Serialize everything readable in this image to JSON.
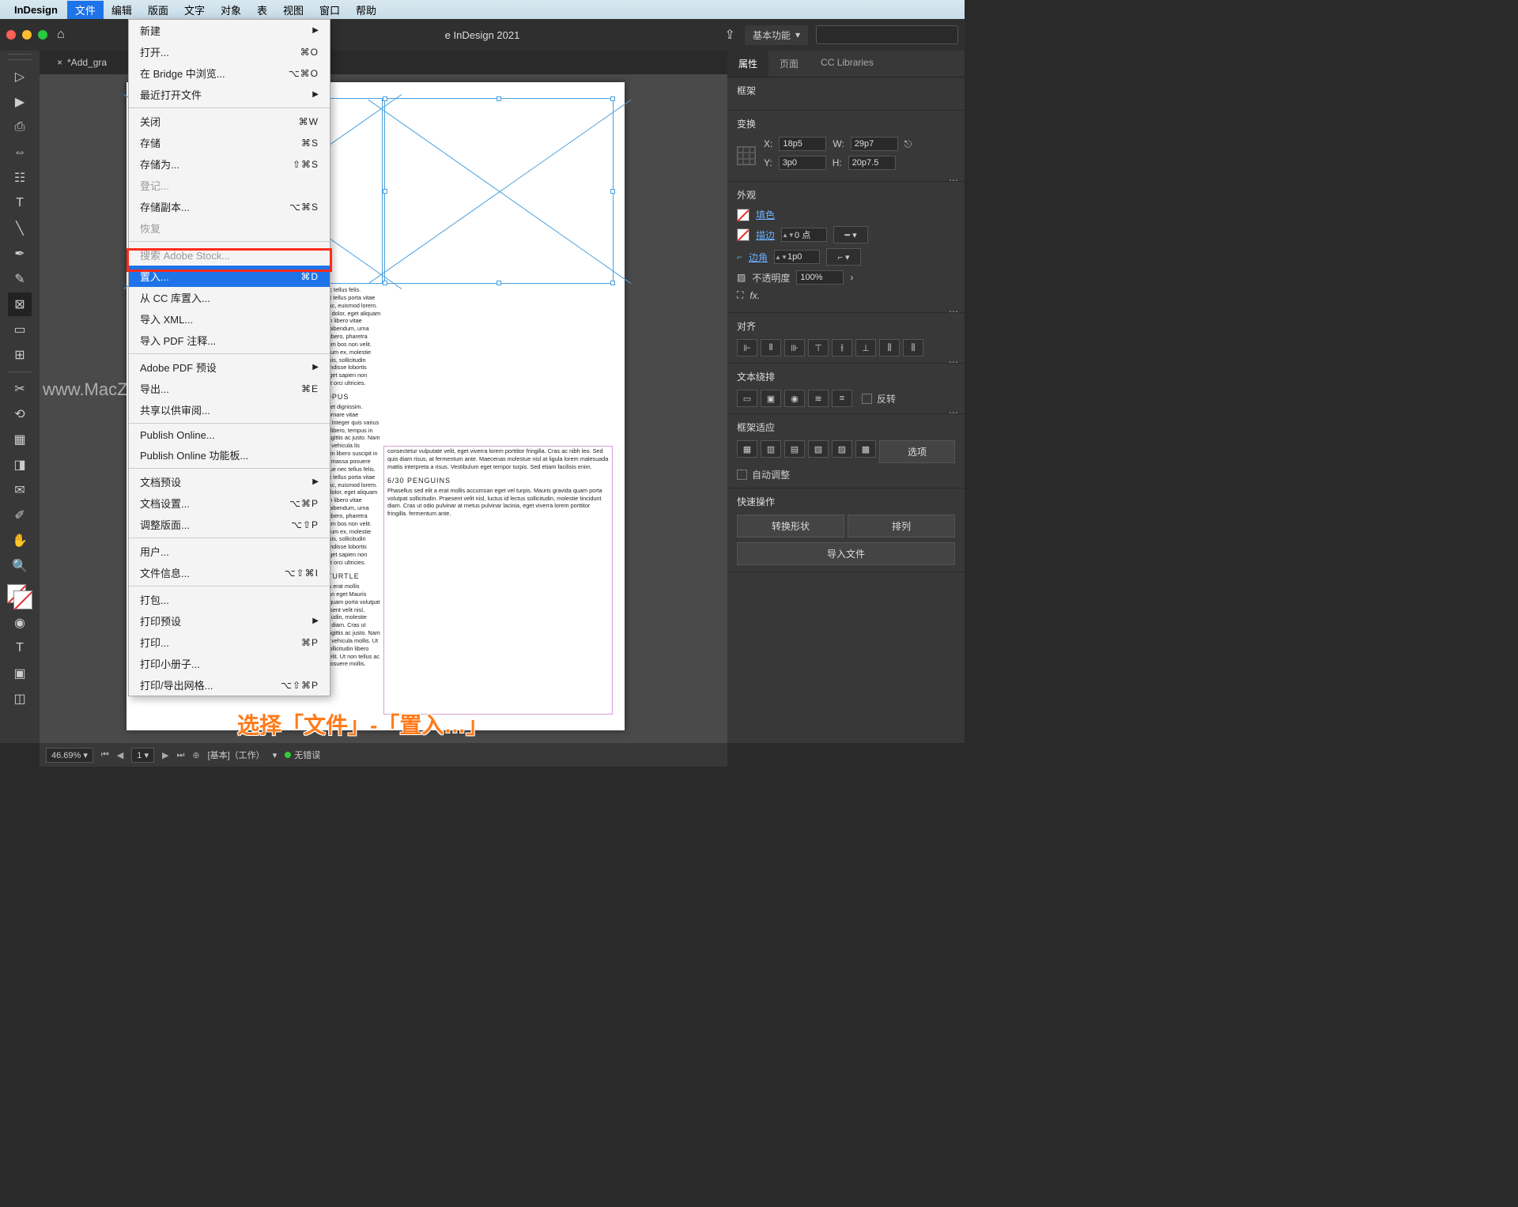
{
  "mac_menu": {
    "app_name": "InDesign",
    "items": [
      "文件",
      "编辑",
      "版面",
      "文字",
      "对象",
      "表",
      "视图",
      "窗口",
      "帮助"
    ],
    "active_index": 0
  },
  "app_bar": {
    "title": "e InDesign 2021",
    "workspace": "基本功能"
  },
  "document_tab": {
    "label": "*Add_gra",
    "close": "×"
  },
  "file_menu": [
    {
      "label": "新建",
      "arrow": true
    },
    {
      "label": "打开...",
      "shortcut": "⌘O"
    },
    {
      "label": "在 Bridge 中浏览...",
      "shortcut": "⌥⌘O"
    },
    {
      "label": "最近打开文件",
      "arrow": true
    },
    {
      "sep": true
    },
    {
      "label": "关闭",
      "shortcut": "⌘W"
    },
    {
      "label": "存储",
      "shortcut": "⌘S"
    },
    {
      "label": "存储为...",
      "shortcut": "⇧⌘S"
    },
    {
      "label": "登记...",
      "disabled": true
    },
    {
      "label": "存储副本...",
      "shortcut": "⌥⌘S"
    },
    {
      "label": "恢复",
      "disabled": true
    },
    {
      "sep": true
    },
    {
      "label": "搜索 Adobe Stock...",
      "disabled": true
    },
    {
      "label": "置入...",
      "shortcut": "⌘D",
      "highlighted": true
    },
    {
      "label": "从 CC 库置入..."
    },
    {
      "label": "导入 XML..."
    },
    {
      "label": "导入 PDF 注释..."
    },
    {
      "sep": true
    },
    {
      "label": "Adobe PDF 预设",
      "arrow": true
    },
    {
      "label": "导出...",
      "shortcut": "⌘E"
    },
    {
      "label": "共享以供审阅..."
    },
    {
      "sep": true
    },
    {
      "label": "Publish Online..."
    },
    {
      "label": "Publish Online 功能板..."
    },
    {
      "sep": true
    },
    {
      "label": "文档预设",
      "arrow": true
    },
    {
      "label": "文档设置...",
      "shortcut": "⌥⌘P"
    },
    {
      "label": "调整版面...",
      "shortcut": "⌥⇧P"
    },
    {
      "sep": true
    },
    {
      "label": "用户..."
    },
    {
      "label": "文件信息...",
      "shortcut": "⌥⇧⌘I"
    },
    {
      "sep": true
    },
    {
      "label": "打包..."
    },
    {
      "label": "打印预设",
      "arrow": true
    },
    {
      "label": "打印...",
      "shortcut": "⌘P"
    },
    {
      "label": "打印小册子..."
    },
    {
      "label": "打印/导出网格...",
      "shortcut": "⌥⇧⌘P"
    }
  ],
  "properties": {
    "tabs": [
      "属性",
      "页面",
      "CC Libraries"
    ],
    "frame_title": "框架",
    "transform_title": "变换",
    "x_label": "X:",
    "x_val": "18p5",
    "w_label": "W:",
    "w_val": "29p7",
    "y_label": "Y:",
    "y_val": "3p0",
    "h_label": "H:",
    "h_val": "20p7.5",
    "appearance_title": "外观",
    "fill_label": "填色",
    "stroke_label": "描边",
    "stroke_val": "0 点",
    "corner_label": "边角",
    "corner_val": "1p0",
    "opacity_label": "不透明度",
    "opacity_val": "100%",
    "fx_label": "fx.",
    "align_title": "对齐",
    "wrap_title": "文本绕排",
    "wrap_invert": "反转",
    "fit_title": "框架适应",
    "fit_options": "选项",
    "auto_fit": "自动调整",
    "quick_title": "快速操作",
    "convert_shape": "转换形状",
    "arrange": "排列",
    "import_file": "导入文件"
  },
  "status": {
    "zoom": "46.69%",
    "page": "1",
    "profile": "[基本]（工作）",
    "errors": "无错误"
  },
  "doc_text": {
    "h1": "OCTOPUS",
    "h2": "SEA TURTLE",
    "h3": "6/30 PENGUINS",
    "para1": "pque nec tellus felis. Praesent tellus porta vitae facilisis ac, euismod lorem. faucilisis dolor, eget aliquam mi. Etiam libero vitae tempus bibendum, urna facilisis libero, pharetra fermentum bos non velit. Nulla ipsum ex, molestie mattis quis, sollicitudin finibus endisse lobortis neque eget sapien non imperdiet orci ultricies.",
    "para2": "tas laoreet dignissim. Nullam ornare vitae aliquam. Integer quis varius ed nunc libero, tempus in tempor agittis ac justo. Nam pharetra vehicula lis sollicitudin libero suscipit in tellus ac massa posuere mollis. que nec tellus felis. Praesent tellus porta vitae facilisis ac, euismod lorem. facilisis dolor, eget aliquam mi. Etiam libero vitae tempus bibendum, urna facilisis libero, pharetra fermentum bos non velit. Nulla ipsum ex, molestie mattis quis, sollicitudin finibus endisse lobortis neque eget sapien non imperdiet orci ultricies.",
    "para3": "sed elit a erat mollis accumsan eget Mauris gravida quam porta volutpat im. Praesent velit nisl, luctus id udin, molestie tincidunt diam. Cras ut ullam, sagittis ac justo. Nam pharetra vehicula mollis. Ut aliquis sollicitudin libero suscipit elit. Ut non tellus ac massa posuere mollis.",
    "para4": "consectetur vulputate velit, eget viverra lorem porttitor fringilla. Cras ac nibh leo. Sed quis diam risus, at fermentum ante. Maecenas molestue nisl at ligula lorem malesuada mattis interpreta a risus. Vestibulum eget tempor turpis. Sed etiam facilisis enim.",
    "para5": "Phasellus sed elit a erat mollis accumsan eget vel turpis. Mauris gravida quam porta volutpat sollicitudin. Praesent velit nisl, luctus id lectus sollicitudin, molestie tincidunt diam. Cras ut odio pulvinar at metus pulvinar lacinia, eget viverra lorem porttitor fringilla. fermentum ante."
  },
  "annotation": "选择「文件」-「置入…」",
  "watermark": "www.MacZ."
}
